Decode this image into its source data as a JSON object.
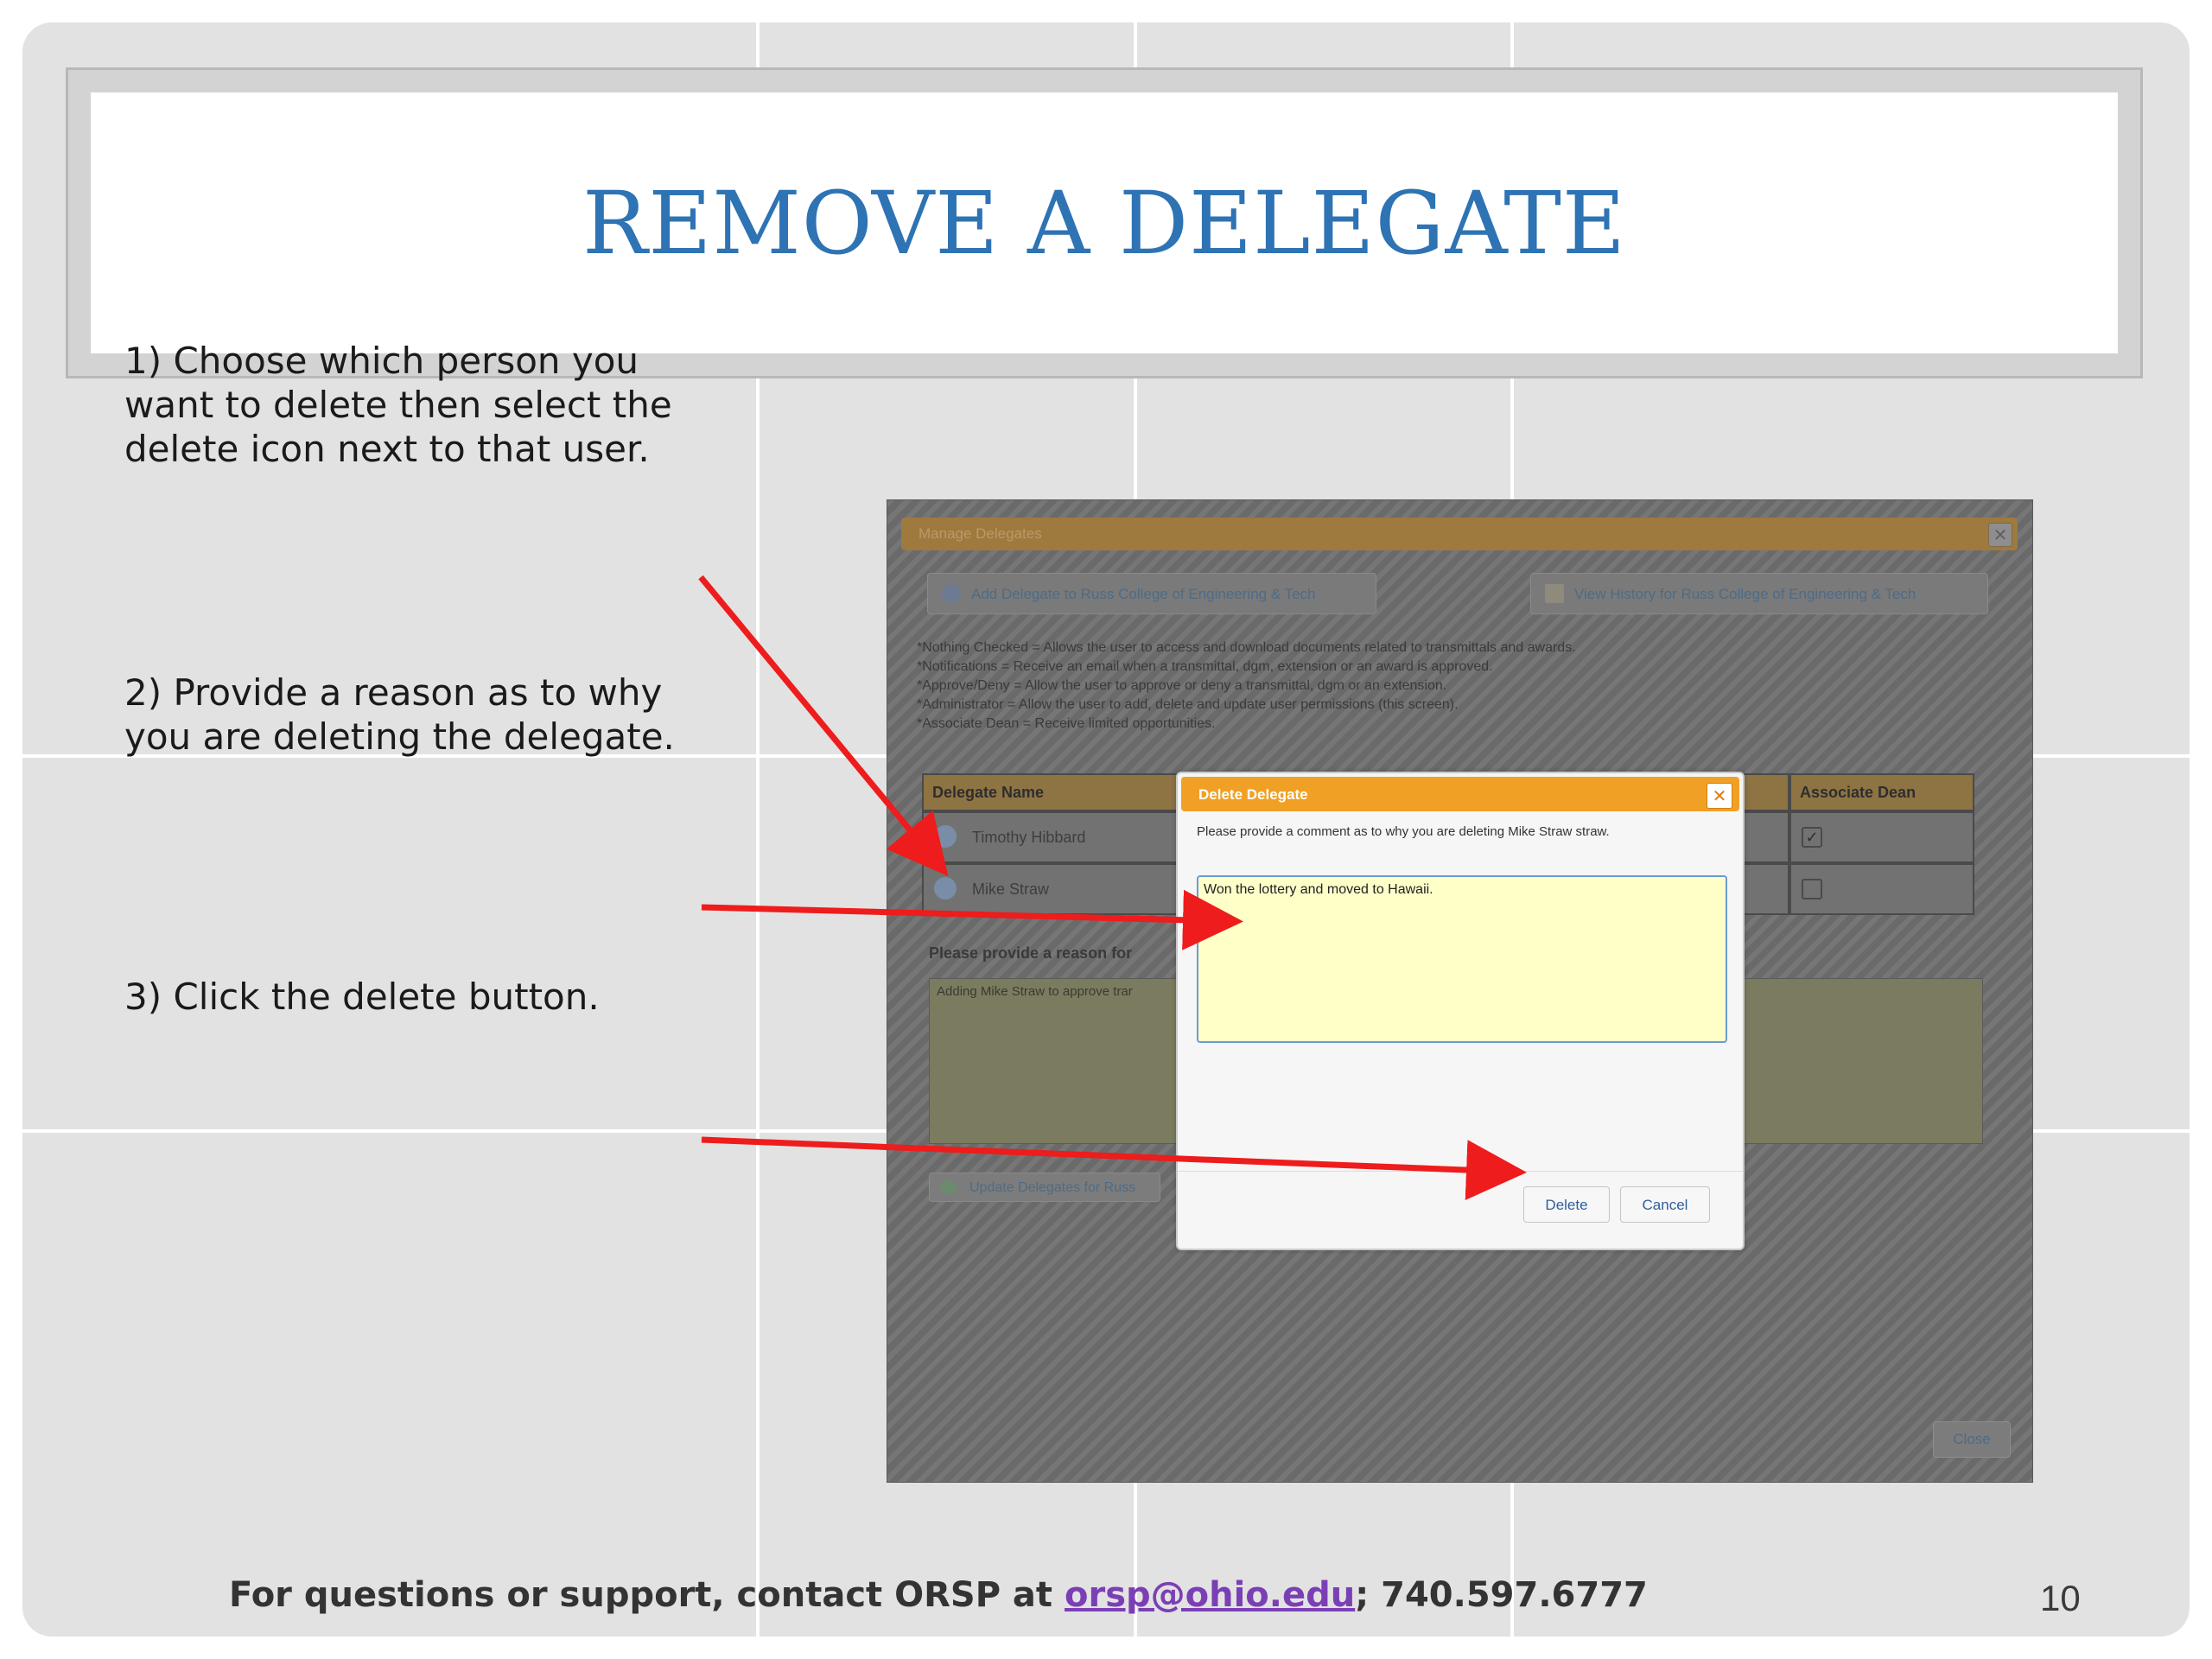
{
  "slide": {
    "title": "REMOVE A DELEGATE",
    "steps": [
      {
        "lines": [
          "1) Choose which person you",
          "want to delete then select the",
          "delete icon next to that user."
        ]
      },
      {
        "lines": [
          "2) Provide a reason as to why",
          "you are deleting the delegate."
        ]
      },
      {
        "lines": [
          "3) Click the delete button."
        ]
      }
    ],
    "footer": {
      "prefix": "For questions or support, contact ORSP at ",
      "email": "orsp@ohio.edu",
      "suffix": "; 740.597.6777"
    },
    "page_number": "10",
    "arrow_color": "#ee1c1c"
  },
  "manage_dialog": {
    "title": "Manage Delegates",
    "close_glyph": "✕",
    "add_button": "Add Delegate to Russ College of Engineering & Tech",
    "history_button": "View History for Russ College of Engineering & Tech",
    "notes": [
      "*Nothing Checked = Allows the user to access and download documents related to transmittals and awards.",
      "*Notifications = Receive an email when a transmittal, dgm, extension or an award is approved.",
      "*Approve/Deny = Allow the user to approve or deny a transmittal, dgm or an extension.",
      "*Administrator = Allow the user to add, delete and update user permissions (this screen).",
      "*Associate Dean = Receive limited opportunities."
    ],
    "columns": {
      "name": "Delegate Name",
      "admin_partial": "r",
      "associate_dean": "Associate Dean"
    },
    "rows": [
      {
        "name": "Timothy Hibbard",
        "associate_dean": "✓"
      },
      {
        "name": "Mike Straw",
        "associate_dean": ""
      }
    ],
    "reason_label": "Please provide a reason for",
    "reason_text": "Adding Mike Straw to approve trar",
    "update_button": "Update Delegates for Russ",
    "close_button": "Close"
  },
  "delete_dialog": {
    "title": "Delete Delegate",
    "close_glyph": "✕",
    "prompt": "Please provide a comment as to why you are deleting Mike Straw straw.",
    "comment_value": "Won the lottery and moved to Hawaii.",
    "delete_button": "Delete",
    "cancel_button": "Cancel",
    "title_bar_color": "#f0a125"
  }
}
